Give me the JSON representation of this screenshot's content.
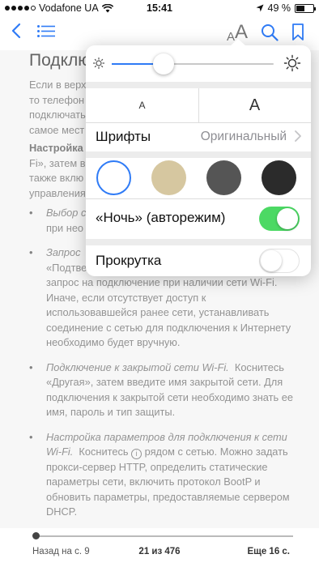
{
  "status": {
    "carrier": "Vodafone UA",
    "time": "15:41",
    "battery": "49 %",
    "battery_level": 0.49
  },
  "nav": {
    "font_small": "A",
    "font_large": "A"
  },
  "book": {
    "heading": "Подклю",
    "intro": [
      "Если в верх",
      "то телефон",
      "подключать",
      "самое мест"
    ],
    "section_title": "Настройка",
    "section_lines": [
      "Fi», затем в",
      "также вклю",
      "управления"
    ],
    "items": [
      {
        "em": "Выбор с",
        "lines": [
          "при нео"
        ]
      },
      {
        "em": "Запрос",
        "lines": [
          "«Подтве",
          "запрос на подключение при наличии сети Wi-Fi.",
          "Иначе, если отсутствует доступ к",
          "использовавшейся ранее сети, устанавливать",
          "соединение с сетью для подключения к Интернету",
          "необходимо будет вручную."
        ]
      },
      {
        "em": "Подключение к закрытой сети Wi-Fi.",
        "text": "Коснитесь «Другая», затем введите имя закрытой сети. Для подключения к закрытой сети необходимо знать ее имя, пароль и тип защиты."
      },
      {
        "em": "Настройка параметров для подключения к сети Wi-Fi.",
        "text_before": "Коснитесь",
        "info_glyph": "i",
        "text_after": "рядом с сетью. Можно задать прокси-сервер HTTP, определить статические параметры сети, включить протокол BootP и обновить параметры, предоставляемые сервером DHCP."
      }
    ]
  },
  "footer": {
    "prev": "Назад на с. 9",
    "current": "21 из 476",
    "remaining": "Еще 16 с.",
    "progress": 0.0
  },
  "popover": {
    "brightness": 0.32,
    "size_small": "A",
    "size_large": "A",
    "fonts_label": "Шрифты",
    "fonts_value": "Оригинальный",
    "themes": [
      {
        "name": "white",
        "color": "#ffffff",
        "selected": true
      },
      {
        "name": "sepia",
        "color": "#d6c7a0",
        "selected": false
      },
      {
        "name": "gray",
        "color": "#555555",
        "selected": false
      },
      {
        "name": "night",
        "color": "#2b2b2b",
        "selected": false
      }
    ],
    "night_label": "«Ночь» (авторежим)",
    "night_on": true,
    "scroll_label": "Прокрутка",
    "scroll_on": false
  },
  "colors": {
    "accent": "#2f7bf6",
    "switch_on": "#4cd964"
  }
}
